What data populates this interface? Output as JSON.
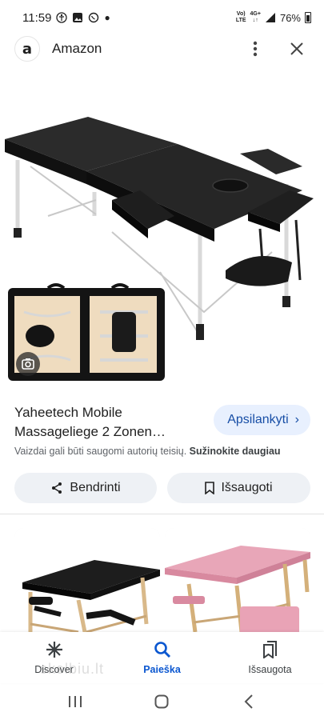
{
  "status": {
    "time": "11:59",
    "net_line1": "Vo)",
    "net_line2": "LTE",
    "net_4g": "4G+",
    "battery": "76%"
  },
  "header": {
    "logo_letter": "a",
    "site_name": "Amazon"
  },
  "product": {
    "title": "Yaheetech Mobile\nMassageliege 2 Zonen…",
    "visit_label": "Apsilankyti",
    "visit_chevron": "›",
    "copyright_text": "Vaizdai gali būti saugomi autorių teisių.",
    "learn_more": "Sužinokite daugiau"
  },
  "actions": {
    "share_label": "Bendrinti",
    "save_label": "Išsaugoti"
  },
  "bottom_nav": {
    "items": [
      {
        "label": "Discover",
        "icon": "asterisk-icon"
      },
      {
        "label": "Paieška",
        "icon": "search-icon"
      },
      {
        "label": "Išsaugota",
        "icon": "saved-icon"
      }
    ],
    "active_index": 1
  },
  "watermark": "skelbiu.lt",
  "colors": {
    "accent": "#0b57d0",
    "visit_bg": "#e8f0fe",
    "button_bg": "#eef1f5",
    "card2_table": "#e8a6b8"
  }
}
